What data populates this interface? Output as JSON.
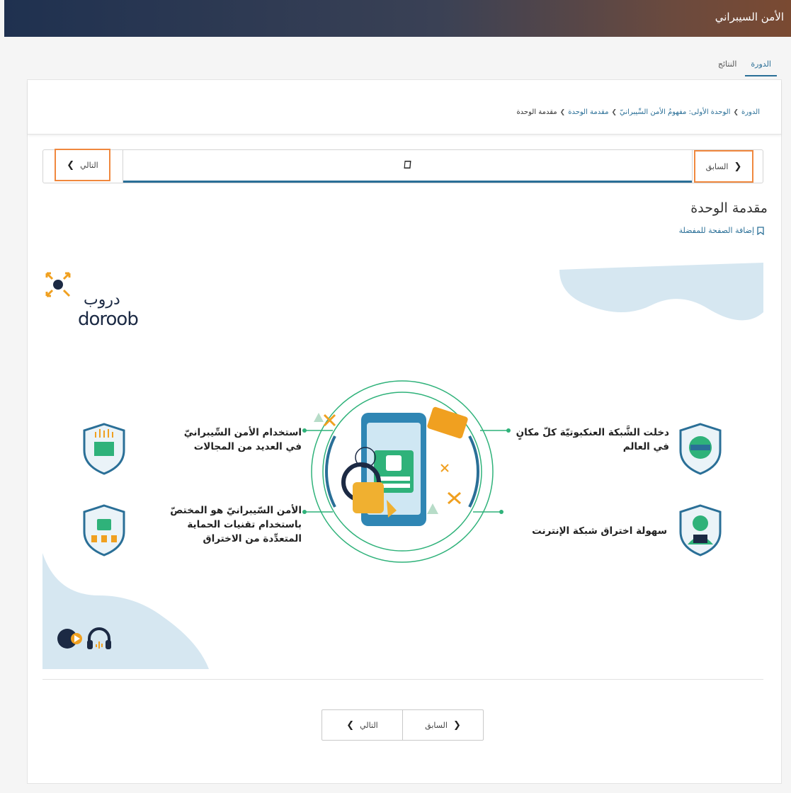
{
  "app": {
    "title": "الأمن السيبراني"
  },
  "tabs": [
    {
      "label": "الدورة",
      "active": true
    },
    {
      "label": "النتائج",
      "active": false
    }
  ],
  "breadcrumb": [
    "الدورة",
    "الوحدة الأولى: مفهومُ الأمن السِّيبرانيّ",
    "مقدمة الوحدة",
    "مقدمة الوحدة"
  ],
  "sequence_nav": {
    "prev_label": "السابق",
    "next_label": "التالي",
    "unit_icon": "book-icon"
  },
  "page": {
    "heading": "مقدمة الوحدة",
    "bookmark_label": "إضافة الصفحة للمفضلة"
  },
  "slide": {
    "logo_text": "doroob",
    "logo_arabic": "دروب",
    "items": {
      "right_top": "دخلت الشَّبكة العنكبوتيّة كلّ مكانٍ في العالم",
      "right_bottom": "سهولة اختراق شبكة الإنترنت",
      "left_top": "استخدام الأمن السِّيبرانيّ في العديد من المجالات",
      "left_bottom": "الأمن السّيبرانيّ هو المختصّ باستخدام تقنيات الحماية المتعدِّدة من الاختراق"
    },
    "accent_colors": {
      "teal": "#2fb27a",
      "blue": "#2a6f97",
      "orange": "#f0a020",
      "light_blue": "#d6e7f1"
    }
  },
  "bottom_nav": {
    "prev_label": "السابق",
    "next_label": "التالي"
  }
}
